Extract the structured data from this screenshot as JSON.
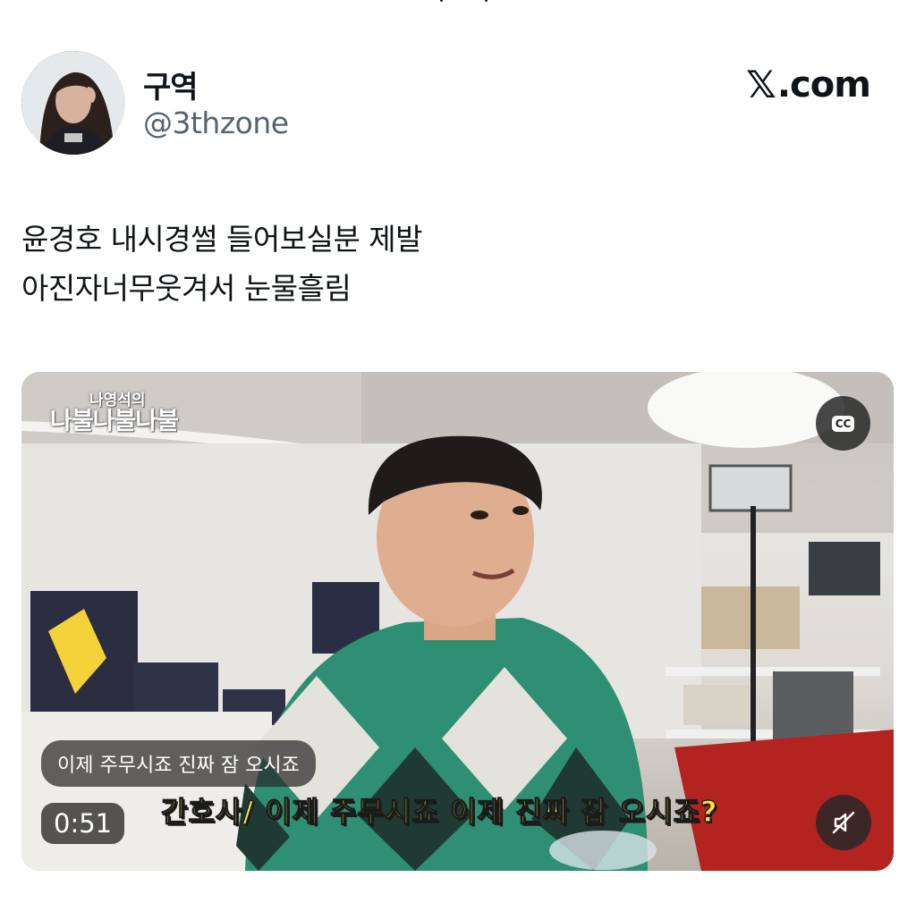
{
  "author": {
    "display_name": "구역",
    "handle": "@3thzone",
    "avatar_icon": "profile-photo"
  },
  "brand": {
    "label": ".com",
    "icon": "x-logo-icon"
  },
  "tweet": {
    "lines": [
      "윤경호 내시경썰 들어보실분 제발",
      "아진자너무웃겨서 눈물흘림"
    ]
  },
  "video": {
    "show_logo_line1": "나영석의",
    "show_logo_line2": "나불나불나불",
    "cc_label": "CC",
    "caption_text": "이제 주무시죠 진짜 잠 오시죠",
    "burned_subtitle": "간호사/ 이제 주무시죠 이제 진짜 잠 오시죠?",
    "timestamp": "0:51",
    "subtitle_color": "#f6e23a",
    "mute_icon": "speaker-muted-icon"
  }
}
